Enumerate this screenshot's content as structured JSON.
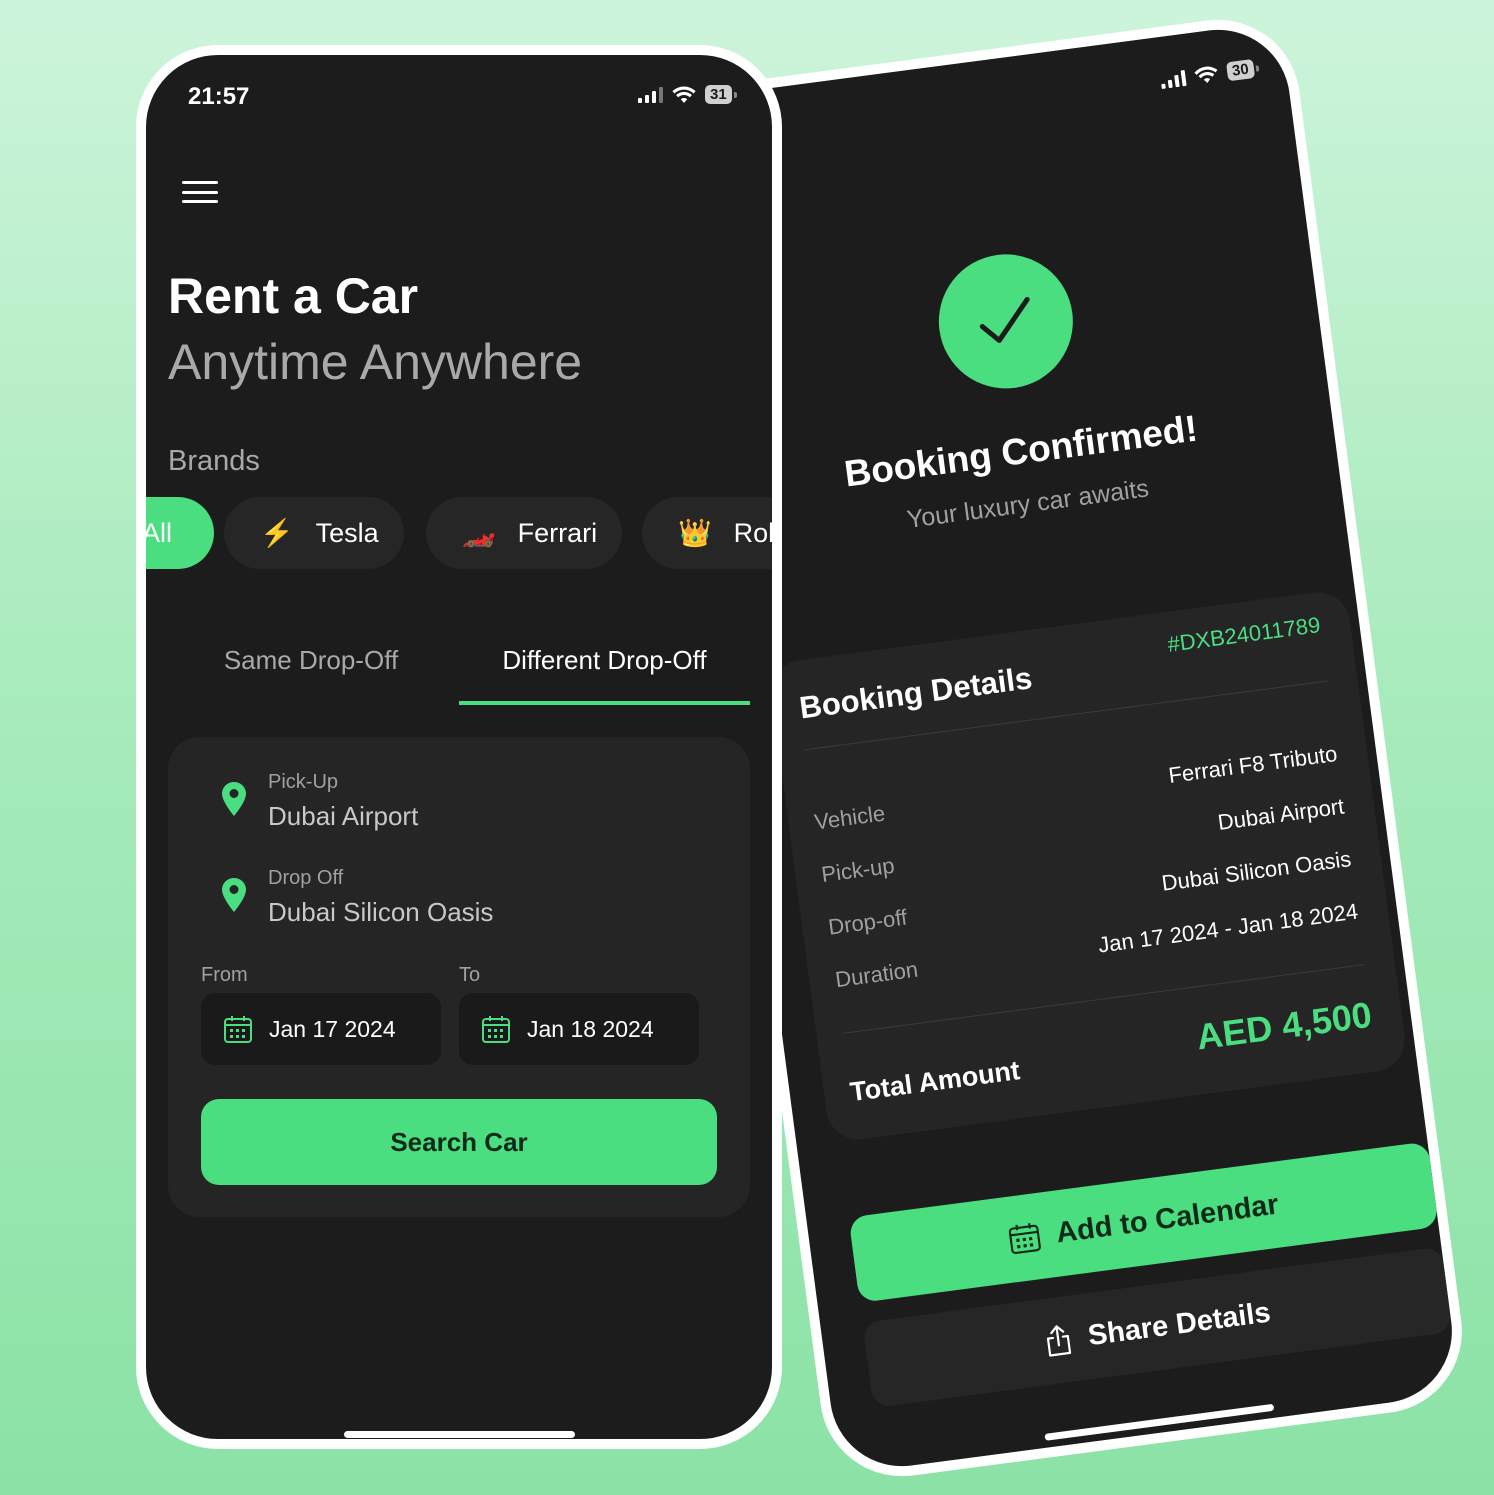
{
  "colors": {
    "accent": "#4ade80",
    "background": "#1c1c1c",
    "card": "#252525"
  },
  "search_screen": {
    "status": {
      "time": "21:57",
      "battery": "31"
    },
    "title": "Rent a Car",
    "subtitle": "Anytime Anywhere",
    "brands_label": "Brands",
    "brands": [
      {
        "label": "All",
        "icon": "",
        "selected": true
      },
      {
        "label": "Tesla",
        "icon": "⚡"
      },
      {
        "label": "Ferrari",
        "icon": "🏎️"
      },
      {
        "label": "Rolls",
        "icon": "👑"
      }
    ],
    "tabs": [
      {
        "label": "Same Drop-Off",
        "selected": false
      },
      {
        "label": "Different Drop-Off",
        "selected": true
      }
    ],
    "pickup": {
      "label": "Pick-Up",
      "value": "Dubai Airport"
    },
    "dropoff": {
      "label": "Drop Off",
      "value": "Dubai Silicon Oasis"
    },
    "from": {
      "label": "From",
      "value": "Jan 17 2024"
    },
    "to": {
      "label": "To",
      "value": "Jan 18 2024"
    },
    "search_button": "Search Car"
  },
  "confirm_screen": {
    "status": {
      "battery": "30"
    },
    "title": "Booking Confirmed!",
    "subtitle": "Your luxury car awaits",
    "details_title": "Booking Details",
    "booking_id": "#DXB24011789",
    "rows": [
      {
        "k": "Vehicle",
        "v": "Ferrari F8 Tributo"
      },
      {
        "k": "Pick-up",
        "v": "Dubai Airport"
      },
      {
        "k": "Drop-off",
        "v": "Dubai Silicon Oasis"
      },
      {
        "k": "Duration",
        "v": "Jan 17 2024 - Jan 18 2024"
      }
    ],
    "total_label": "Total Amount",
    "total_value": "AED 4,500",
    "calendar_button": "Add to Calendar",
    "share_button": "Share Details"
  }
}
